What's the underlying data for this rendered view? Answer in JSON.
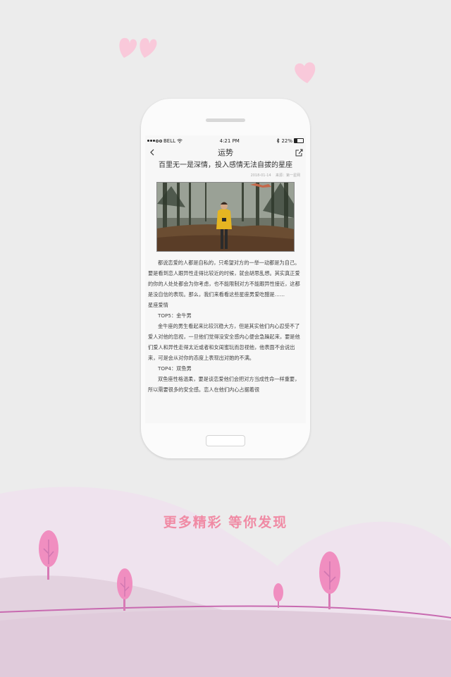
{
  "status_bar": {
    "carrier": "BELL",
    "time": "4:21 PM",
    "battery": "22%"
  },
  "nav": {
    "title": "运势",
    "back_icon": "chevron-left-icon",
    "share_icon": "share-icon"
  },
  "article": {
    "title": "百里无一是深情，投入感情无法自拔的星座",
    "date": "2018-01-14",
    "source": "来源：第一星网",
    "paragraphs": [
      "都说恋爱的人都是自私的，只希望对方的一举一动都是为自己。要是看到恋人跟异性走得比较近的时候，就会胡思乱想。其实真正爱的你的人处处都会为你考虑，也不能限制对方不能跟异性接近，这都是没自信的表现。那么，我们来看看这些星座男爱吃醋是……",
      "星座爱情",
      "TOP5：金牛男",
      "金牛座的男生看起来比较沉稳大方，但是其实他们内心忍受不了爱人对他的忽视，一旦他们觉得没安全感内心便会急躁起来，要是他们爱人和异性走得太近或者和女闺蜜玩而忽视他，他表面不会说出来，可是会从对你的态度上表现出对她的不满。",
      "TOP4：双鱼男",
      "双鱼座性格温柔，要是谈恋爱他们会把对方当成性命一样重要，所以需要很多的安全感。恋人在他们内心占据着很"
    ]
  },
  "slogan": "更多精彩  等你发现",
  "colors": {
    "accent": "#f08aa4",
    "hill_light": "#efe4ee",
    "hill_dark": "#e3d2df",
    "line": "#c86ab0",
    "tree": "#f08ec0"
  }
}
